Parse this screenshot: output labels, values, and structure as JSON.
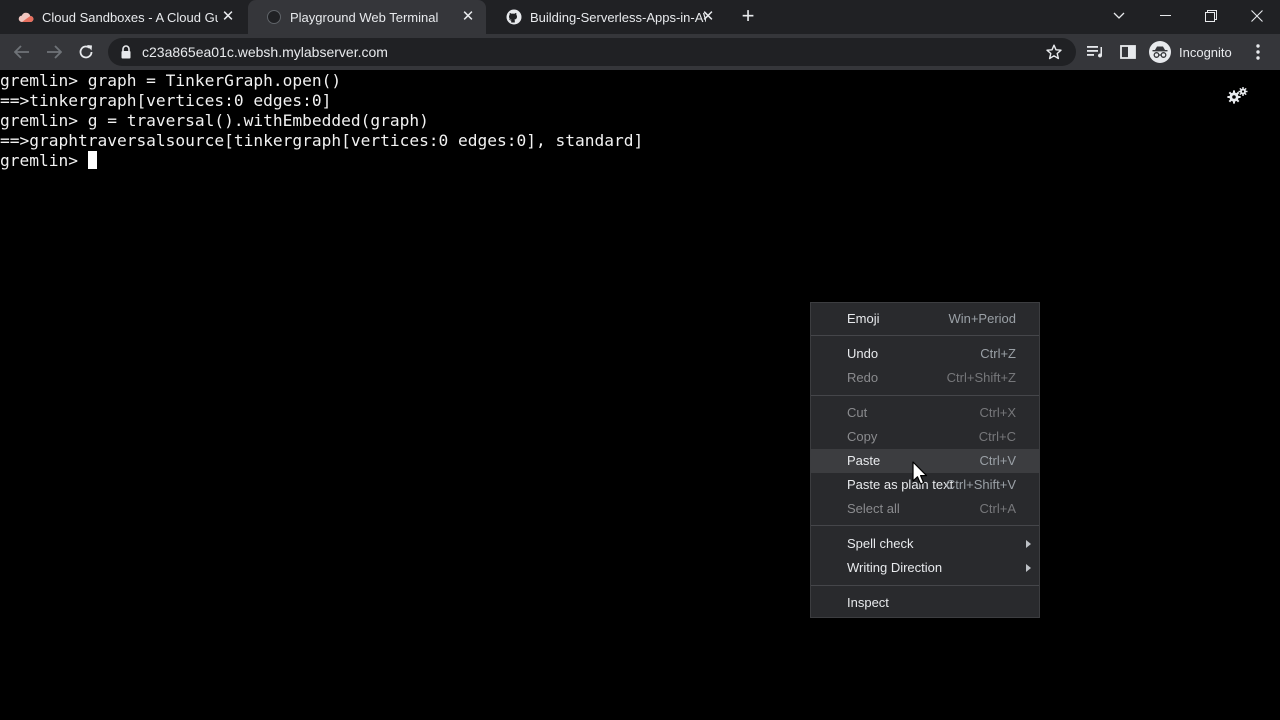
{
  "tabs": [
    {
      "title": "Cloud Sandboxes - A Cloud Guru",
      "icon": "cloud-icon",
      "active": false
    },
    {
      "title": "Playground Web Terminal",
      "icon": "terminal-favicon",
      "active": true
    },
    {
      "title": "Building-Serverless-Apps-in-AWS",
      "icon": "github-icon",
      "active": false
    }
  ],
  "toolbar": {
    "url": "c23a865ea01c.websh.mylabserver.com",
    "profile_label": "Incognito"
  },
  "terminal": {
    "lines": [
      "gremlin> graph = TinkerGraph.open()",
      "==>tinkergraph[vertices:0 edges:0]",
      "gremlin> g = traversal().withEmbedded(graph)",
      "==>graphtraversalsource[tinkergraph[vertices:0 edges:0], standard]",
      "gremlin> "
    ]
  },
  "context_menu": {
    "items": [
      {
        "label": "Emoji",
        "shortcut": "Win+Period",
        "enabled": true
      },
      {
        "label": "Undo",
        "shortcut": "Ctrl+Z",
        "enabled": true
      },
      {
        "label": "Redo",
        "shortcut": "Ctrl+Shift+Z",
        "enabled": false
      },
      {
        "label": "Cut",
        "shortcut": "Ctrl+X",
        "enabled": false
      },
      {
        "label": "Copy",
        "shortcut": "Ctrl+C",
        "enabled": false
      },
      {
        "label": "Paste",
        "shortcut": "Ctrl+V",
        "enabled": true,
        "hovered": true
      },
      {
        "label": "Paste as plain text",
        "shortcut": "Ctrl+Shift+V",
        "enabled": true
      },
      {
        "label": "Select all",
        "shortcut": "Ctrl+A",
        "enabled": false
      },
      {
        "label": "Spell check",
        "shortcut": "",
        "enabled": true,
        "submenu": true
      },
      {
        "label": "Writing Direction",
        "shortcut": "",
        "enabled": true,
        "submenu": true
      },
      {
        "label": "Inspect",
        "shortcut": "",
        "enabled": true
      }
    ]
  },
  "colors": {
    "tabstrip": "#202124",
    "toolbar": "#35363a",
    "terminal_bg": "#000000",
    "menu_bg": "#292a2d"
  }
}
